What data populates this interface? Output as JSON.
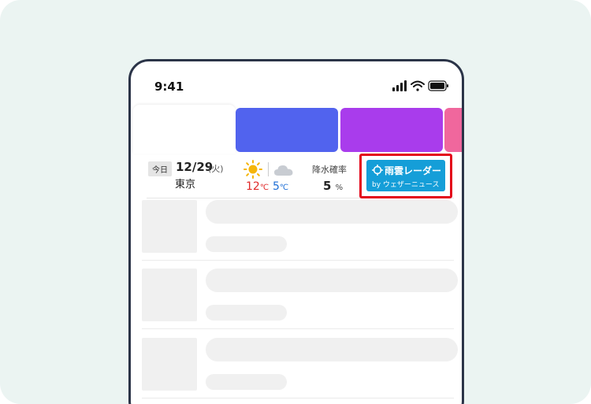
{
  "status_bar": {
    "time": "9:41"
  },
  "tabs": [
    {
      "name": "tab-1",
      "color": "#ffffff"
    },
    {
      "name": "tab-2",
      "color": "#5163ee"
    },
    {
      "name": "tab-3",
      "color": "#a93cec"
    },
    {
      "name": "tab-4",
      "color": "#f0679d"
    }
  ],
  "weather": {
    "today_label": "今日",
    "date": "12/29",
    "day_of_week": "(火)",
    "city": "東京",
    "high": "12",
    "low": "5",
    "temp_unit": "℃",
    "precip_label": "降水確率",
    "precip_value": "5",
    "precip_unit": "%",
    "icons": [
      "sun-icon",
      "cloud-icon"
    ]
  },
  "radar_button": {
    "title": "雨雲レーダー",
    "subtitle": "by ウェザーニュース",
    "color": "#159ed8",
    "highlight_color": "#e3061a"
  },
  "colors": {
    "temp_high": "#e02a2a",
    "temp_low": "#1f6fd6",
    "background": "#ebf4f2",
    "frame": "#2b3448"
  }
}
